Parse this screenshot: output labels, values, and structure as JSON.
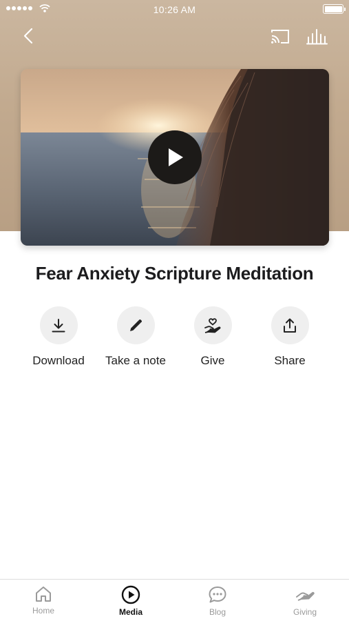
{
  "status_bar": {
    "time": "10:26 AM"
  },
  "media": {
    "title": "Fear Anxiety Scripture Meditation"
  },
  "actions": [
    {
      "label": "Download",
      "icon": "download-icon"
    },
    {
      "label": "Take a note",
      "icon": "pencil-icon"
    },
    {
      "label": "Give",
      "icon": "give-heart-hand-icon"
    },
    {
      "label": "Share",
      "icon": "share-icon"
    }
  ],
  "tabs": [
    {
      "label": "Home",
      "icon": "home-icon",
      "active": false
    },
    {
      "label": "Media",
      "icon": "play-circle-icon",
      "active": true
    },
    {
      "label": "Blog",
      "icon": "chat-bubble-icon",
      "active": false
    },
    {
      "label": "Giving",
      "icon": "hand-icon",
      "active": false
    }
  ],
  "colors": {
    "hero_background": "#c2aa8f",
    "action_circle": "#efefef",
    "tab_active": "#111111",
    "tab_inactive": "#9a9a9a"
  }
}
